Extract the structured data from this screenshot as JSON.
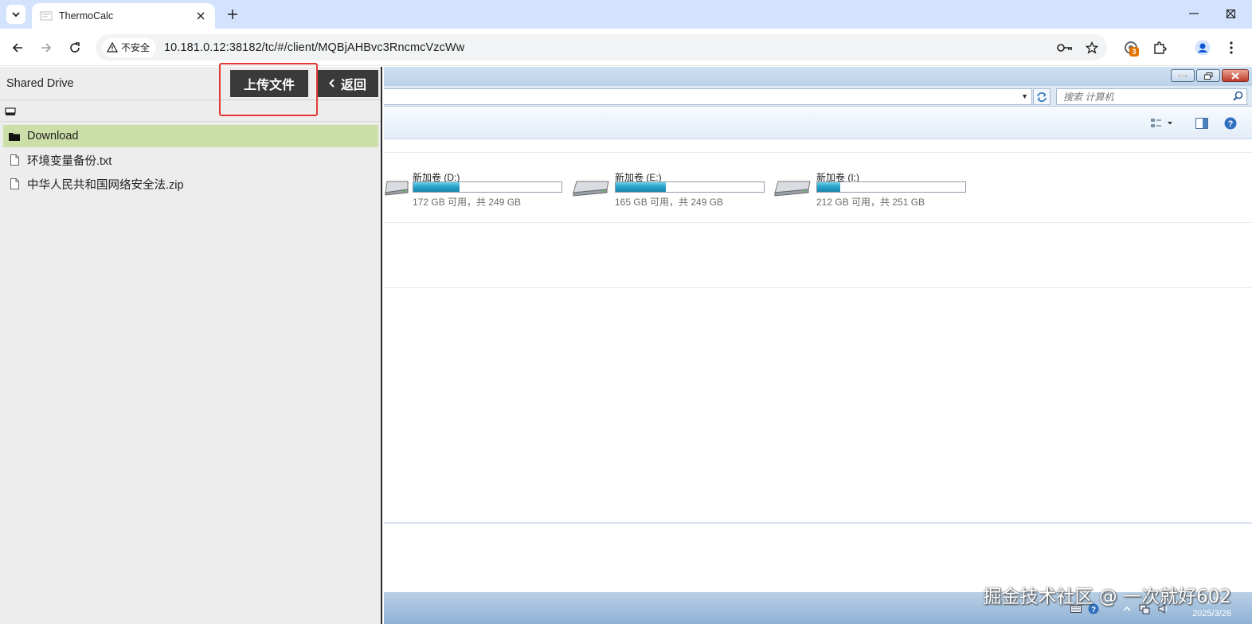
{
  "browser": {
    "tab_title": "ThermoCalc",
    "security_label": "不安全",
    "url": "10.181.0.12:38182/tc/#/client/MQBjAHBvc3RncmcVzcWw",
    "extension_badge": "3"
  },
  "panel": {
    "title": "Shared Drive",
    "upload_label": "上传文件",
    "back_label": "返回",
    "files": [
      {
        "name": "Download",
        "type": "folder",
        "selected": true
      },
      {
        "name": "环境变量备份.txt",
        "type": "file",
        "selected": false
      },
      {
        "name": "中华人民共和国网络安全法.zip",
        "type": "file",
        "selected": false
      }
    ]
  },
  "remote": {
    "search_placeholder": "搜索 计算机",
    "drives": [
      {
        "name": "新加卷 (D:)",
        "info": "172 GB 可用，共 249 GB",
        "used_fraction": 0.31
      },
      {
        "name": "新加卷 (E:)",
        "info": "165 GB 可用，共 249 GB",
        "used_fraction": 0.34
      },
      {
        "name": "新加卷 (I:)",
        "info": "212 GB 可用，共 251 GB",
        "used_fraction": 0.155
      }
    ],
    "clock_time": "21:57",
    "clock_date": "2025/3/26"
  },
  "watermark": "掘金技术社区 @ 一次就好602",
  "colors": {
    "tabstrip": "#d3e3fd",
    "panel_bg": "#ededed",
    "selected_row": "#cddfa8",
    "button_bg": "#3a3a3a",
    "highlight": "#e53935"
  }
}
